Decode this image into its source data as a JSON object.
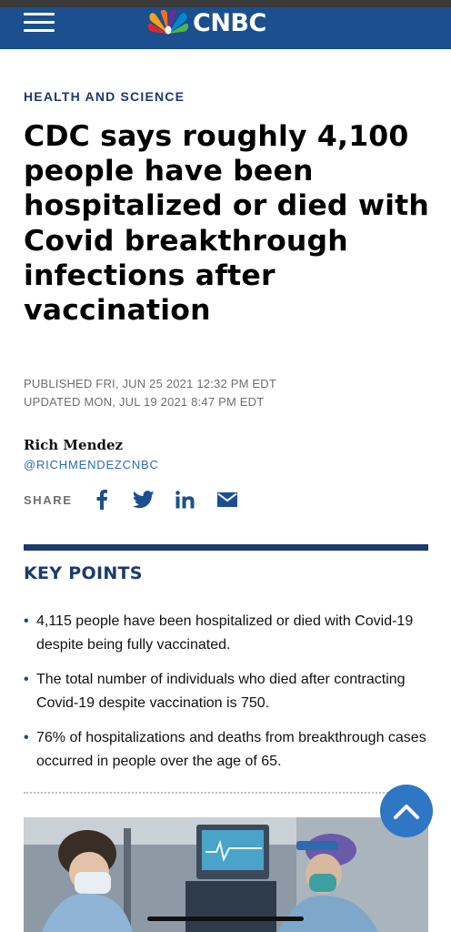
{
  "header": {
    "menu_icon": "hamburger-menu-icon",
    "logo_icon": "nbc-peacock-icon",
    "logo_text": "CNBC",
    "bg_color": "#1b4f8f"
  },
  "article": {
    "category": "HEALTH AND SCIENCE",
    "headline": "CDC says roughly 4,100 people have been hospitalized or died with Covid breakthrough infections after vaccination",
    "published": "PUBLISHED FRI, JUN 25 2021 12:32 PM EDT",
    "updated": "UPDATED MON, JUL 19 2021 8:47 PM EDT",
    "author": "Rich Mendez",
    "author_handle": "@RICHMENDEZCNBC"
  },
  "share": {
    "label": "SHARE",
    "icons": [
      "facebook-icon",
      "twitter-icon",
      "linkedin-icon",
      "email-icon"
    ]
  },
  "key_points": {
    "title": "KEY POINTS",
    "items": [
      "4,115 people have been hospitalized or died with Covid-19 despite being fully vaccinated.",
      "The total number of individuals who died after contracting Covid-19 despite vaccination is 750.",
      "76% of hospitalizations and deaths from breakthrough cases occurred in people over the age of 65."
    ]
  },
  "colors": {
    "navy": "#1b3a6e",
    "link_blue": "#2a6cb3",
    "scroll_button": "#2e77c4"
  },
  "scroll_top_icon": "chevron-up-icon"
}
